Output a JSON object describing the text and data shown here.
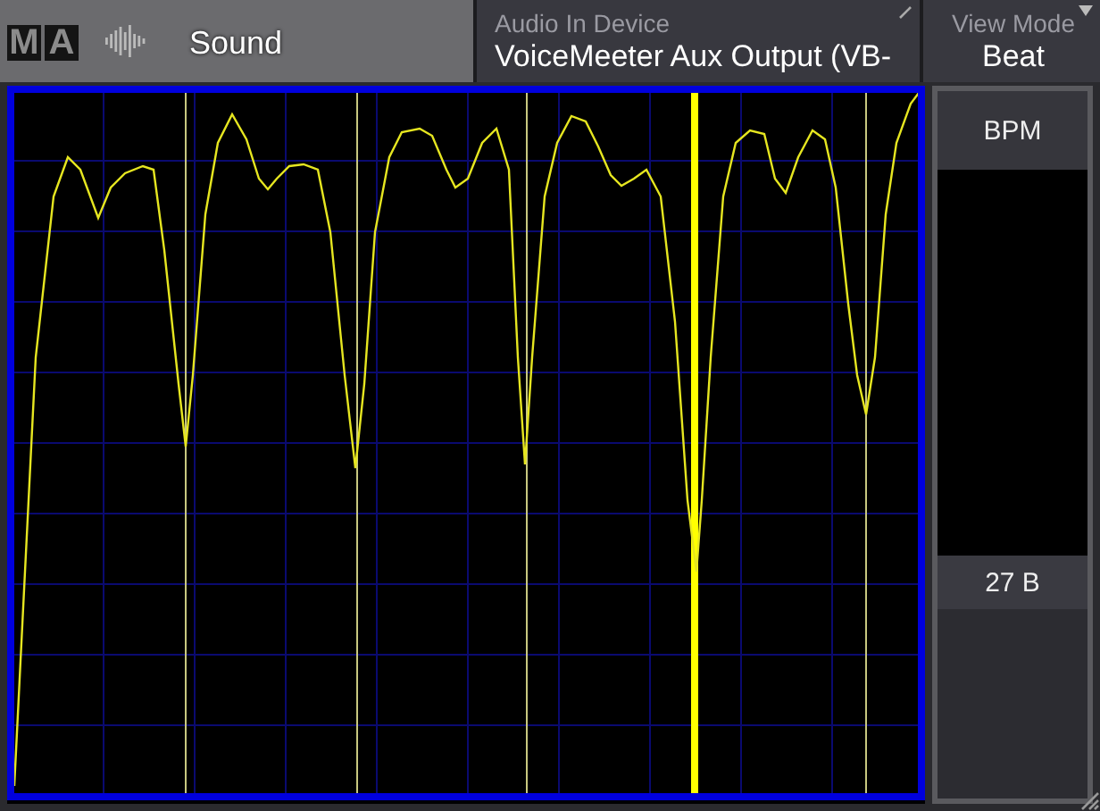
{
  "logo": [
    "M",
    "A"
  ],
  "window": {
    "title": "Sound"
  },
  "audio_in_device": {
    "label": "Audio In Device",
    "value": "VoiceMeeter Aux Output (VB-"
  },
  "view_mode": {
    "label": "View Mode",
    "value": "Beat"
  },
  "meter": {
    "label": "BPM",
    "reading": "27 B"
  }
}
